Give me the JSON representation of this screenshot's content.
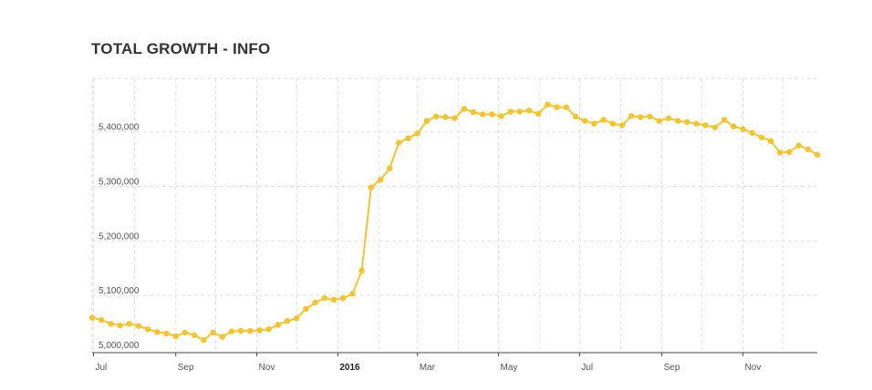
{
  "chart_data": {
    "type": "line",
    "title": "TOTAL GROWTH - INFO",
    "xlabel": "",
    "ylabel": "",
    "color": "#f7c427",
    "grid": true,
    "y_ticks": [
      5000000,
      5100000,
      5200000,
      5300000,
      5400000
    ],
    "y_tick_labels": [
      "5,000,000",
      "5,100,000",
      "5,200,000",
      "5,300,000",
      "5,400,000"
    ],
    "ylim": [
      4995000,
      5498000
    ],
    "xlim": [
      "2015-06-30",
      "2016-12-27"
    ],
    "x_ticks": [
      "2015-07-01",
      "2015-09-01",
      "2015-11-01",
      "2016-01-01",
      "2016-03-01",
      "2016-05-01",
      "2016-07-01",
      "2016-09-01",
      "2016-11-01"
    ],
    "x_tick_labels": [
      "Jul",
      "Sep",
      "Nov",
      "2016",
      "Mar",
      "May",
      "Jul",
      "Sep",
      "Nov"
    ],
    "x_tick_bold": [
      false,
      false,
      false,
      true,
      false,
      false,
      false,
      false,
      false
    ],
    "x_minor_ticks": [
      "2015-08-01",
      "2015-10-01",
      "2015-12-01",
      "2016-02-01",
      "2016-04-01",
      "2016-06-01",
      "2016-08-01",
      "2016-10-01",
      "2016-12-01"
    ],
    "x": [
      "2015-06-30",
      "2015-07-07",
      "2015-07-14",
      "2015-07-21",
      "2015-07-28",
      "2015-08-04",
      "2015-08-11",
      "2015-08-18",
      "2015-08-25",
      "2015-09-01",
      "2015-09-08",
      "2015-09-15",
      "2015-09-22",
      "2015-09-29",
      "2015-10-06",
      "2015-10-13",
      "2015-10-20",
      "2015-10-27",
      "2015-11-03",
      "2015-11-10",
      "2015-11-17",
      "2015-11-24",
      "2015-12-01",
      "2015-12-08",
      "2015-12-15",
      "2015-12-22",
      "2015-12-29",
      "2016-01-05",
      "2016-01-12",
      "2016-01-19",
      "2016-01-26",
      "2016-02-02",
      "2016-02-09",
      "2016-02-16",
      "2016-02-23",
      "2016-03-01",
      "2016-03-08",
      "2016-03-15",
      "2016-03-22",
      "2016-03-29",
      "2016-04-05",
      "2016-04-12",
      "2016-04-19",
      "2016-04-26",
      "2016-05-03",
      "2016-05-10",
      "2016-05-17",
      "2016-05-24",
      "2016-05-31",
      "2016-06-07",
      "2016-06-14",
      "2016-06-21",
      "2016-06-28",
      "2016-07-05",
      "2016-07-12",
      "2016-07-19",
      "2016-07-26",
      "2016-08-02",
      "2016-08-09",
      "2016-08-16",
      "2016-08-23",
      "2016-08-30",
      "2016-09-06",
      "2016-09-13",
      "2016-09-20",
      "2016-09-27",
      "2016-10-04",
      "2016-10-11",
      "2016-10-18",
      "2016-10-25",
      "2016-11-01",
      "2016-11-08",
      "2016-11-15",
      "2016-11-22",
      "2016-11-29",
      "2016-12-06",
      "2016-12-13",
      "2016-12-20",
      "2016-12-27"
    ],
    "series": [
      {
        "values": [
          5059000,
          5055000,
          5048000,
          5045000,
          5048000,
          5044000,
          5038000,
          5033000,
          5030000,
          5025000,
          5032000,
          5027000,
          5018000,
          5032000,
          5024000,
          5034000,
          5035000,
          5035000,
          5036000,
          5038000,
          5046000,
          5053000,
          5058000,
          5075000,
          5087000,
          5095000,
          5092000,
          5095000,
          5103000,
          5145000,
          5298000,
          5312000,
          5333000,
          5380000,
          5388000,
          5397000,
          5420000,
          5428000,
          5427000,
          5425000,
          5442000,
          5436000,
          5432000,
          5432000,
          5429000,
          5437000,
          5437000,
          5439000,
          5433000,
          5450000,
          5445000,
          5445000,
          5428000,
          5420000,
          5415000,
          5422000,
          5415000,
          5412000,
          5429000,
          5427000,
          5428000,
          5420000,
          5425000,
          5420000,
          5418000,
          5415000,
          5412000,
          5408000,
          5422000,
          5410000,
          5405000,
          5398000,
          5390000,
          5383000,
          5362000,
          5363000,
          5375000,
          5368000,
          5358000,
          5340000
        ]
      }
    ]
  }
}
